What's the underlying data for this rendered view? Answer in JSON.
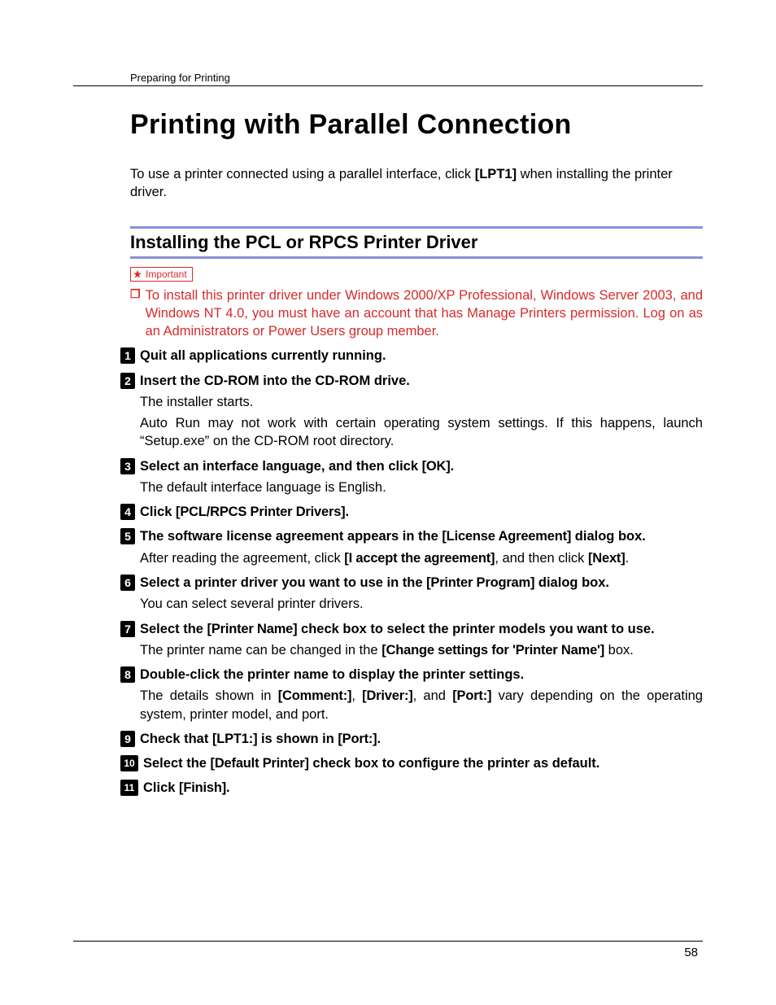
{
  "running_head": "Preparing for Printing",
  "title": "Printing with Parallel Connection",
  "intro_pre": "To use a printer connected using a parallel interface, click ",
  "intro_ui": "[LPT1]",
  "intro_post": " when installing the printer driver.",
  "section_heading": "Installing the PCL or RPCS Printer Driver",
  "important_label": "Important",
  "note_text": "To install this printer driver under Windows 2000/XP Professional, Windows Server 2003, and Windows NT 4.0, you must have an account that has Manage Printers permission. Log on as an Administrators or Power Users group member.",
  "steps": {
    "s1": {
      "num": "1",
      "title": "Quit all applications currently running."
    },
    "s2": {
      "num": "2",
      "title": "Insert the CD-ROM into the CD-ROM drive.",
      "body1": "The installer starts.",
      "body2": "Auto Run may not work with certain operating system settings. If this happens, launch “Setup.exe” on the CD-ROM root directory."
    },
    "s3": {
      "num": "3",
      "title_pre": "Select an interface language, and then click ",
      "title_ui": "[OK]",
      "title_post": ".",
      "body1": "The default interface language is English."
    },
    "s4": {
      "num": "4",
      "title_pre": "Click ",
      "title_ui": "[PCL/RPCS Printer Drivers]",
      "title_post": "."
    },
    "s5": {
      "num": "5",
      "title_pre": "The software license agreement appears in the ",
      "title_ui": "[License Agreement]",
      "title_post": " dialog box.",
      "body_pre": "After reading the agreement, click ",
      "body_ui1": "[I accept the agreement]",
      "body_mid": ", and then click ",
      "body_ui2": "[Next]",
      "body_post": "."
    },
    "s6": {
      "num": "6",
      "title_pre": "Select a printer driver you want to use in the ",
      "title_ui": "[Printer Program]",
      "title_post": " dialog box.",
      "body1": "You can select several printer drivers."
    },
    "s7": {
      "num": "7",
      "title_pre": "Select the ",
      "title_ui": "[Printer Name]",
      "title_post": " check box to select the printer models you want to use.",
      "body_pre": "The printer name can be changed in the ",
      "body_ui": "[Change settings for 'Printer Name']",
      "body_post": " box."
    },
    "s8": {
      "num": "8",
      "title": "Double-click the printer name to display the printer settings.",
      "body_pre": "The details shown in ",
      "body_ui1": "[Comment:]",
      "body_mid1": ", ",
      "body_ui2": "[Driver:]",
      "body_mid2": ", and ",
      "body_ui3": "[Port:]",
      "body_post": " vary depending on the operating system, printer model, and port."
    },
    "s9": {
      "num": "9",
      "title_pre": "Check that ",
      "title_ui1": "[LPT1:]",
      "title_mid": " is shown in ",
      "title_ui2": "[Port:]",
      "title_post": "."
    },
    "s10": {
      "num": "10",
      "title_pre": "Select the ",
      "title_ui": "[Default Printer]",
      "title_post": " check box to configure the printer as default."
    },
    "s11": {
      "num": "11",
      "title_pre": "Click ",
      "title_ui": "[Finish]",
      "title_post": "."
    }
  },
  "page_number": "58"
}
